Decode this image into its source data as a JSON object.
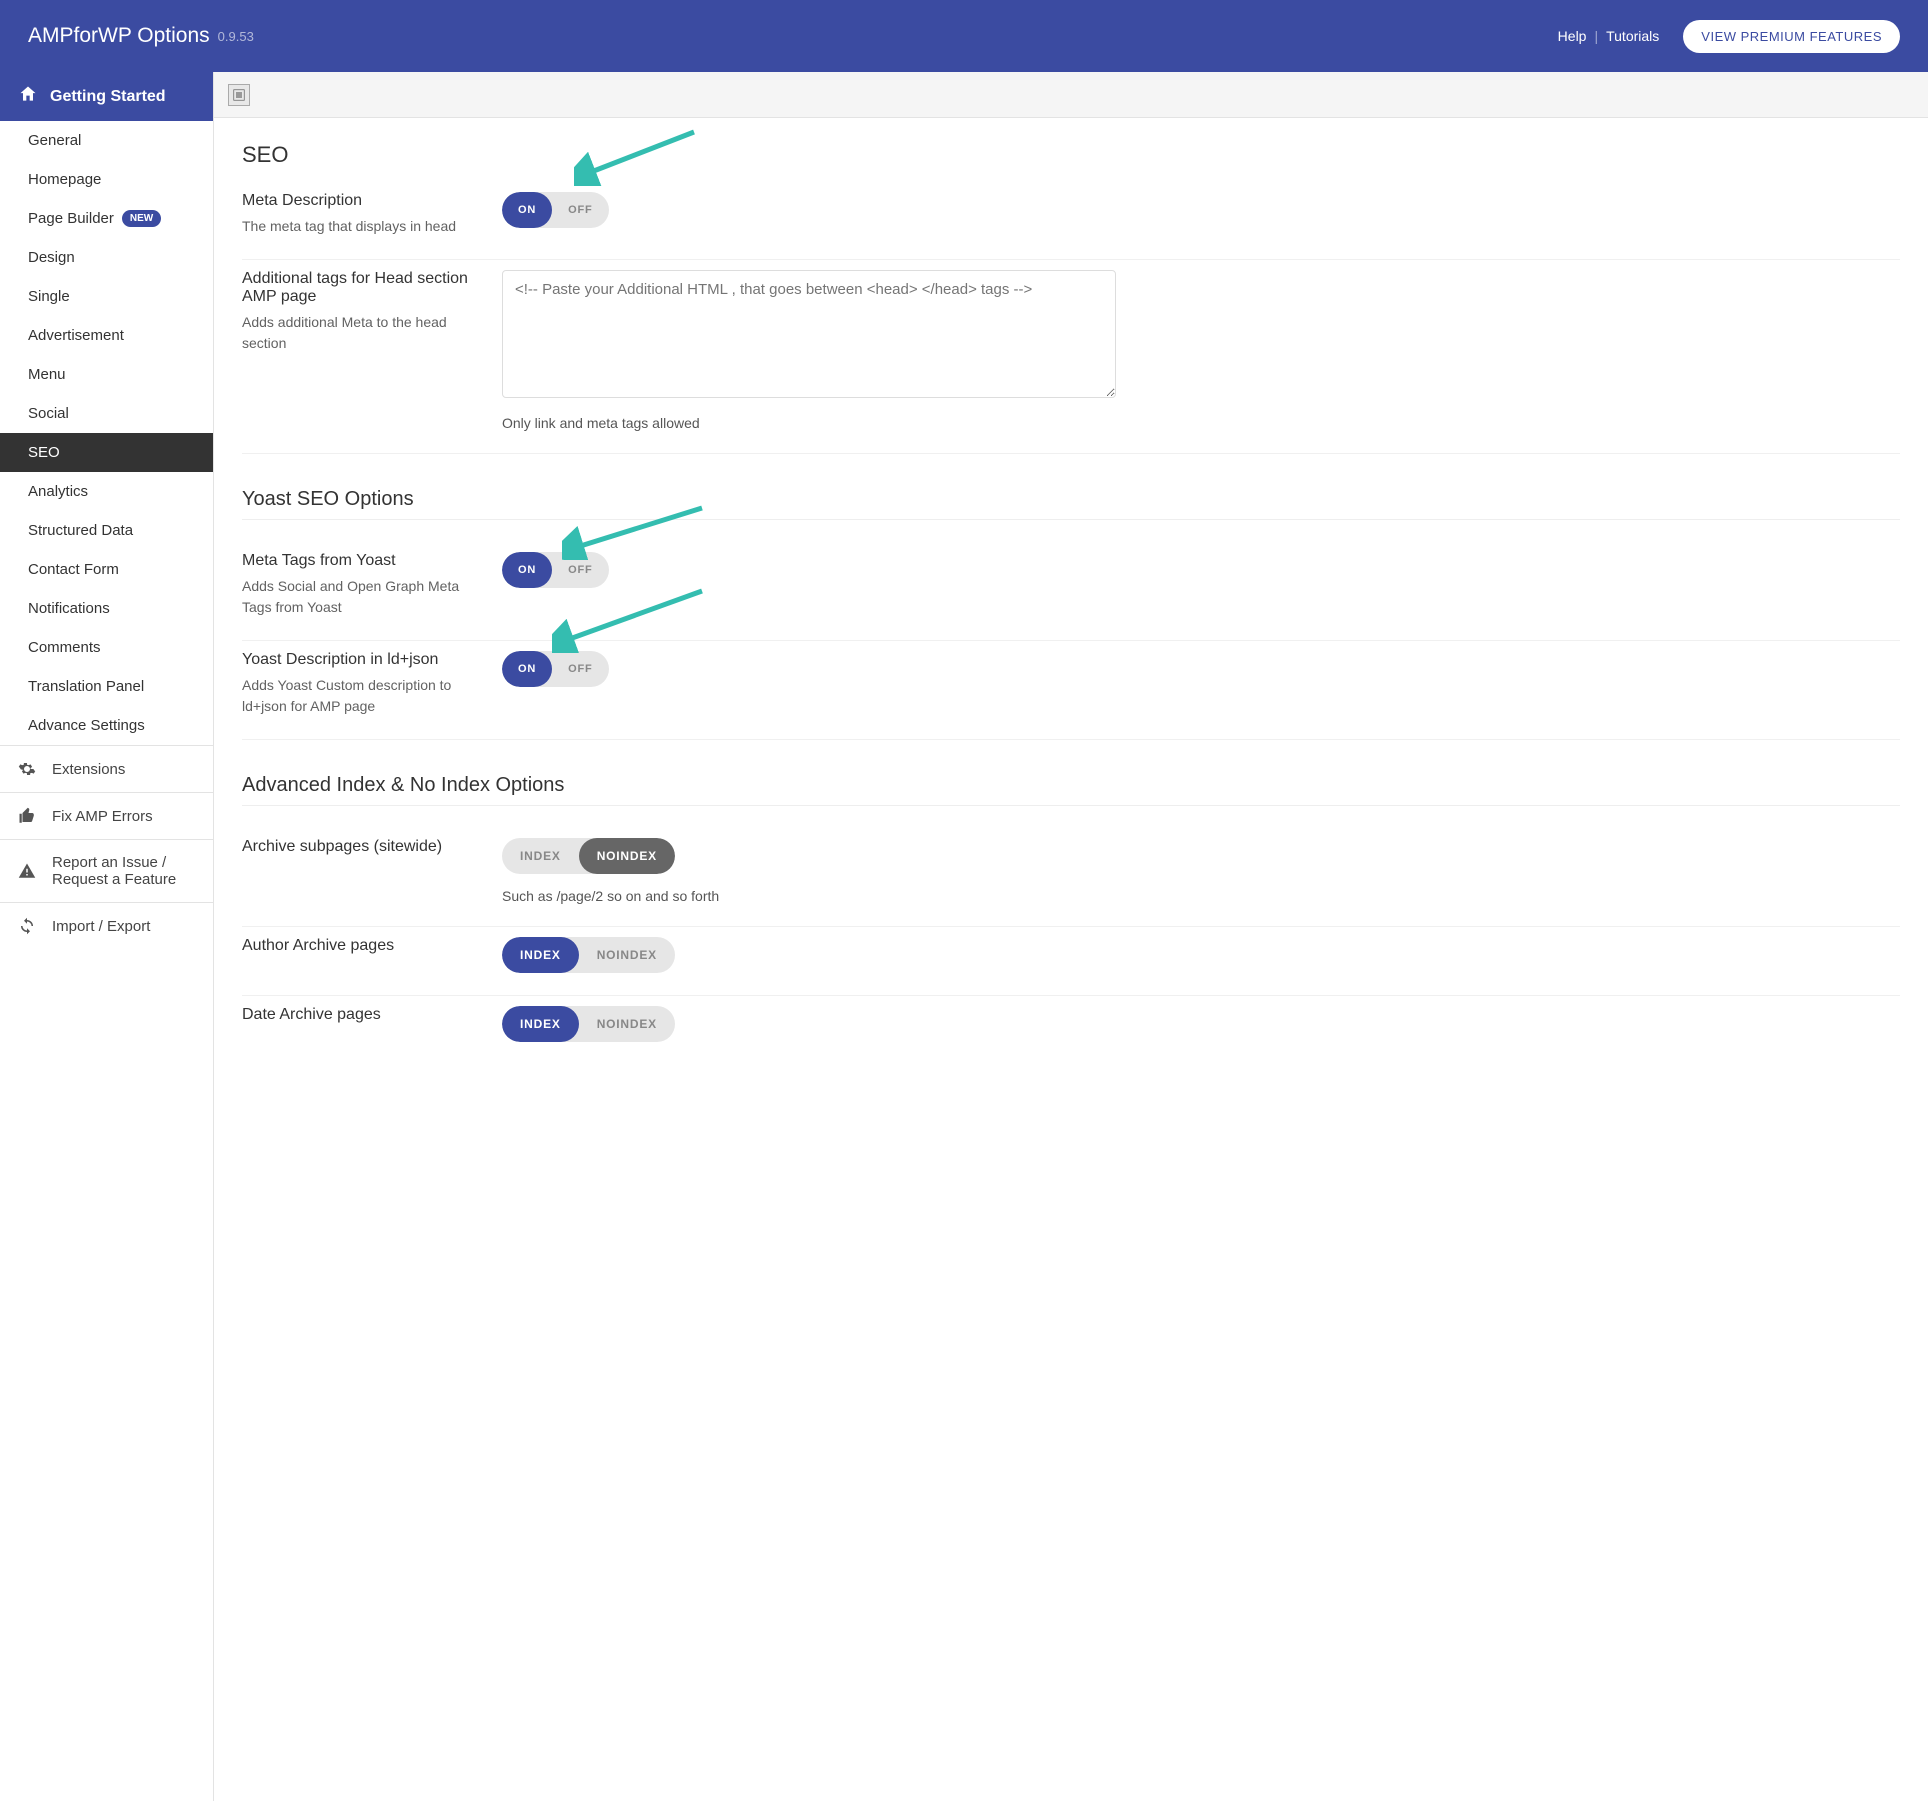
{
  "header": {
    "title": "AMPforWP Options",
    "version": "0.9.53",
    "help": "Help",
    "tutorials": "Tutorials",
    "premium": "VIEW PREMIUM FEATURES"
  },
  "sidebar": {
    "getting_started": "Getting Started",
    "items": [
      {
        "label": "General"
      },
      {
        "label": "Homepage"
      },
      {
        "label": "Page Builder",
        "badge": "NEW"
      },
      {
        "label": "Design"
      },
      {
        "label": "Single"
      },
      {
        "label": "Advertisement"
      },
      {
        "label": "Menu"
      },
      {
        "label": "Social"
      },
      {
        "label": "SEO",
        "active": true
      },
      {
        "label": "Analytics"
      },
      {
        "label": "Structured Data"
      },
      {
        "label": "Contact Form"
      },
      {
        "label": "Notifications"
      },
      {
        "label": "Comments"
      },
      {
        "label": "Translation Panel"
      },
      {
        "label": "Advance Settings"
      }
    ],
    "secondary": [
      {
        "icon": "gear",
        "label": "Extensions"
      },
      {
        "icon": "thumb",
        "label": "Fix AMP Errors"
      },
      {
        "icon": "warn",
        "label": "Report an Issue / Request a Feature"
      },
      {
        "icon": "sync",
        "label": "Import / Export"
      }
    ]
  },
  "seo": {
    "title": "SEO",
    "meta_desc": {
      "label": "Meta Description",
      "desc": "The meta tag that displays in head",
      "on": "ON",
      "off": "OFF",
      "value": "on"
    },
    "head_tags": {
      "label": "Additional tags for Head section AMP page",
      "desc": "Adds additional Meta to the head section",
      "placeholder": "<!-- Paste your Additional HTML , that goes between <head> </head> tags -->",
      "hint": "Only link and meta tags allowed"
    }
  },
  "yoast": {
    "title": "Yoast SEO Options",
    "meta_tags": {
      "label": "Meta Tags from Yoast",
      "desc": "Adds Social and Open Graph Meta Tags from Yoast",
      "on": "ON",
      "off": "OFF",
      "value": "on"
    },
    "ldjson": {
      "label": "Yoast Description in ld+json",
      "desc": "Adds Yoast Custom description to ld+json for AMP page",
      "on": "ON",
      "off": "OFF",
      "value": "on"
    }
  },
  "adv": {
    "title": "Advanced Index & No Index Options",
    "archive": {
      "label": "Archive subpages (sitewide)",
      "index": "INDEX",
      "noindex": "NOINDEX",
      "value": "noindex",
      "hint": "Such as /page/2 so on and so forth"
    },
    "author": {
      "label": "Author Archive pages",
      "index": "INDEX",
      "noindex": "NOINDEX",
      "value": "index"
    },
    "date": {
      "label": "Date Archive pages",
      "index": "INDEX",
      "noindex": "NOINDEX",
      "value": "index"
    }
  }
}
